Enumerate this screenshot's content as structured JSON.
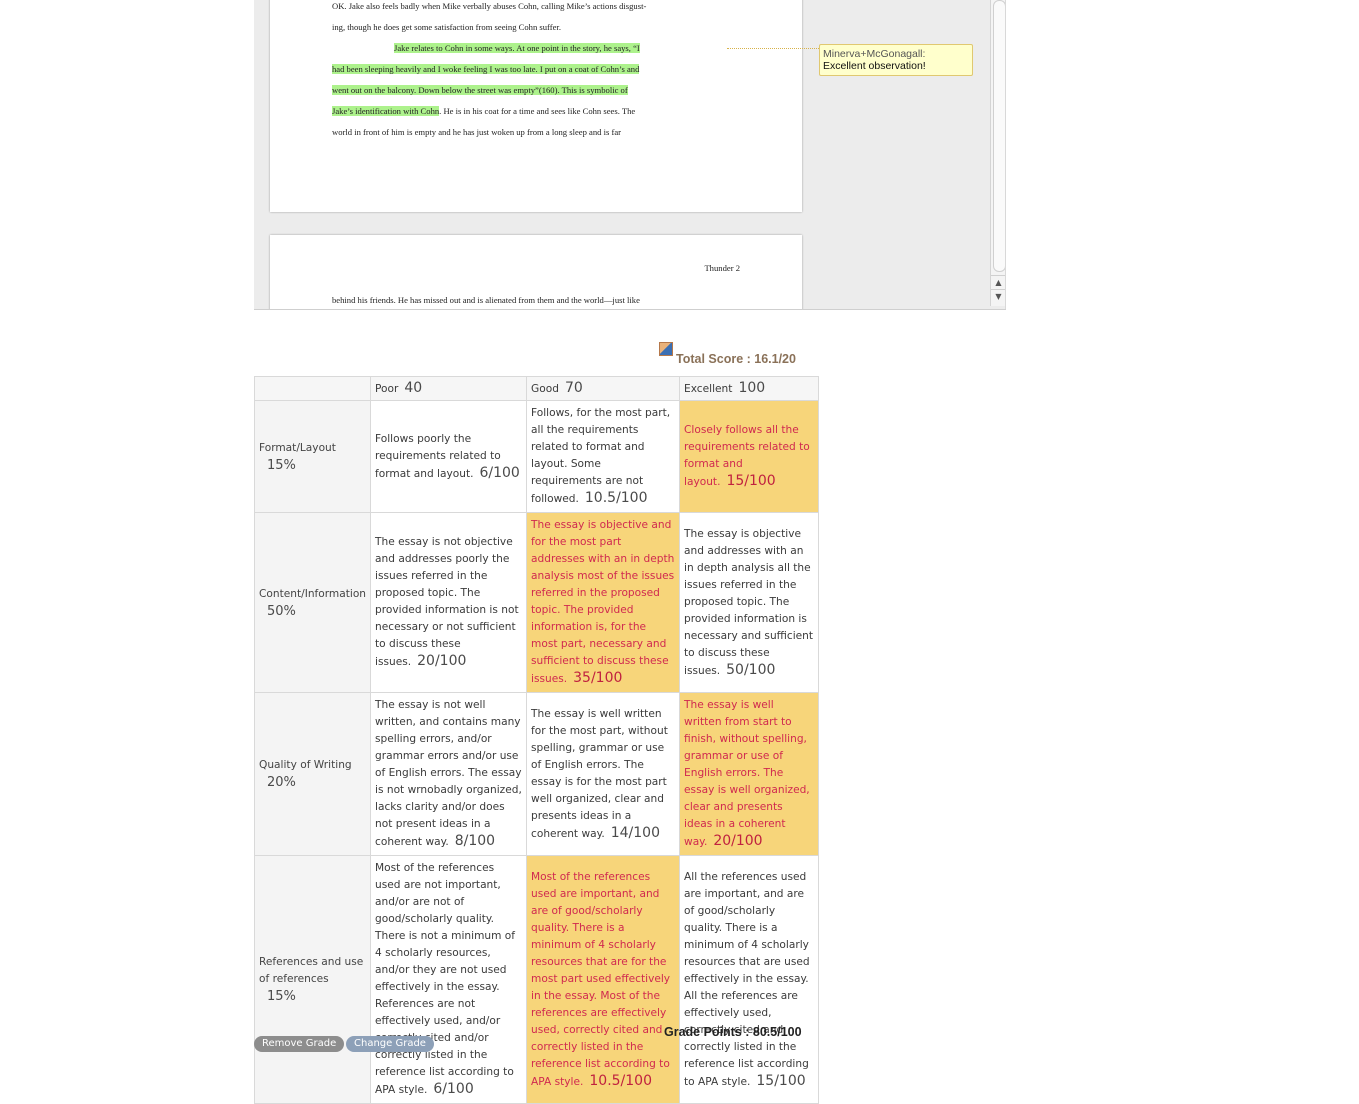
{
  "document": {
    "page1_lines": [
      "OK. Jake also feels badly when Mike verbally abuses Cohn, calling Mike’s actions disgust-",
      "ing, though he does get some satisfaction from seeing Cohn suffer."
    ],
    "highlight_line1": "Jake relates to Cohn in some ways. At one point in the story, he says, “I",
    "highlight_line2": "had been sleeping heavily and I woke feeling I was too late. I put on a coat of Cohn’s and",
    "highlight_line3": "went out on the balcony. Down below the street was empty”(160). This is symbolic of",
    "highlight_line4": "Jake’s identification with Cohn",
    "line4_rest": ". He is in his coat for a time and sees like Cohn sees. The",
    "line5": "world in front of him is empty and he has just woken up from a long sleep and is far",
    "page2_header": "Thunder 2",
    "page2_line": "behind his friends. He has missed out and is alienated from them and the world—just like"
  },
  "comment": {
    "author": "Minerva+McGonagall:",
    "text": "Excellent observation!"
  },
  "total_score": "Total Score : 16.1/20",
  "levels": [
    {
      "name": "Poor",
      "points": "40"
    },
    {
      "name": "Good",
      "points": "70"
    },
    {
      "name": "Excellent",
      "points": "100"
    }
  ],
  "criteria": [
    {
      "name": "Format/Layout",
      "weight": "15%",
      "cells": [
        {
          "text": "Follows poorly the requirements related to format and layout.",
          "score": "6/100"
        },
        {
          "text": "Follows, for the most part, all the requirements related to format and layout. Some requirements are not followed.",
          "score": "10.5/100"
        },
        {
          "text": "Closely follows all the requirements related to format and layout.",
          "score": "15/100"
        }
      ],
      "selected": 2
    },
    {
      "name": "Content/Information",
      "weight": "50%",
      "cells": [
        {
          "text": "The essay is not objective and addresses poorly the issues referred in the proposed topic. The provided information is not necessary or not sufficient to discuss these issues.",
          "score": "20/100"
        },
        {
          "text": "The essay is objective and for the most part addresses with an in depth analysis most of the issues referred in the proposed topic. The provided information is, for the most part, necessary and sufficient to discuss these issues.",
          "score": "35/100"
        },
        {
          "text": "The essay is objective and addresses with an in depth analysis all the issues referred in the proposed topic. The provided information is necessary and sufficient to discuss these issues.",
          "score": "50/100"
        }
      ],
      "selected": 1
    },
    {
      "name": "Quality of Writing",
      "weight": "20%",
      "cells": [
        {
          "text": "The essay is not well written, and contains many spelling errors, and/or grammar errors and/or use of English errors. The essay is not wrnobadly organized, lacks clarity and/or does not present ideas in a coherent way.",
          "score": "8/100"
        },
        {
          "text": "The essay is well written for the most part, without spelling, grammar or use of English errors. The essay is for the most part well organized, clear and presents ideas in a coherent way.",
          "score": "14/100"
        },
        {
          "text": "The essay is well written from start to finish, without spelling, grammar or use of English errors. The essay is well organized, clear and presents ideas in a coherent way.",
          "score": "20/100"
        }
      ],
      "selected": 2
    },
    {
      "name": "References and use of references",
      "weight": "15%",
      "cells": [
        {
          "text": "Most of the references used are not important, and/or are not of good/scholarly quality. There is not a minimum of 4 scholarly resources, and/or they are not used effectively in the essay. References are not effectively used, and/or correctly cited and/or correctly listed in the reference list according to APA style.",
          "score": "6/100"
        },
        {
          "text": "Most of the references used are important, and are of good/scholarly quality. There is a minimum of 4 scholarly resources that are for the most part used effectively in the essay. Most of the references are effectively used, correctly cited and correctly listed in the reference list according to APA style.",
          "score": "10.5/100"
        },
        {
          "text": "All the references used are important, and are of good/scholarly quality. There is a minimum of 4 scholarly resources that are used effectively in the essay. All the references are effectively used, correctly cited and correctly listed in the reference list according to APA style.",
          "score": "15/100"
        }
      ],
      "selected": 1
    }
  ],
  "grade_points": "Grade Points : 80.5/100",
  "buttons": {
    "remove": "Remove Grade",
    "change": "Change Grade"
  },
  "colors": {
    "selected_bg": "#f7d57a",
    "selected_text": "#d0294f",
    "highlight": "#adf28c",
    "comment_bg": "#ffffcc"
  }
}
